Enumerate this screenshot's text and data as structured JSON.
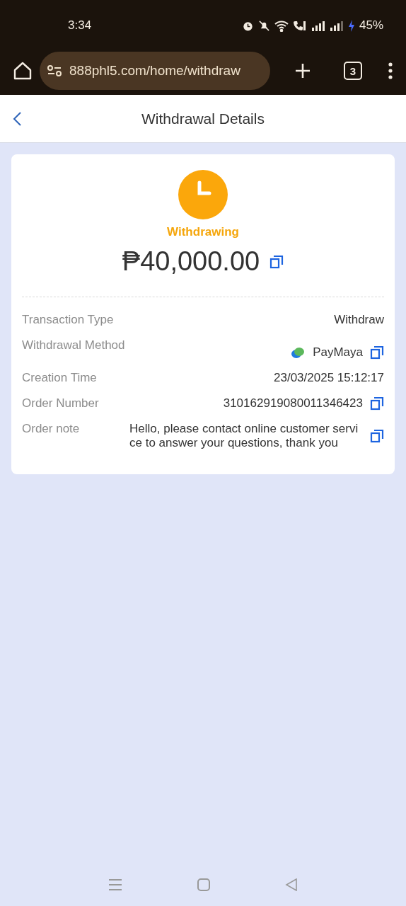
{
  "status_bar": {
    "time": "3:34",
    "battery": "45%"
  },
  "browser": {
    "url": "888phl5.com/home/withdraw",
    "tab_count": "3"
  },
  "header": {
    "title": "Withdrawal Details"
  },
  "summary": {
    "status": "Withdrawing",
    "amount": "₱40,000.00"
  },
  "details": [
    {
      "label": "Transaction Type",
      "value": "Withdraw",
      "kind": "text",
      "copyable": false
    },
    {
      "label": "Withdrawal Method",
      "value": "PayMaya",
      "kind": "method",
      "copyable": true
    },
    {
      "label": "Creation Time",
      "value": "23/03/2025 15:12:17",
      "kind": "text",
      "copyable": false
    },
    {
      "label": "Order Number",
      "value": "310162919080011346423",
      "kind": "text",
      "copyable": true
    },
    {
      "label": "Order note",
      "value": "Hello, please contact online customer service to answer your questions, thank you",
      "kind": "note",
      "copyable": true
    }
  ]
}
